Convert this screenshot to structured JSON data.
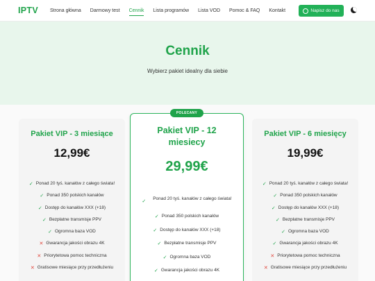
{
  "nav": {
    "logo": "IPTV",
    "links": [
      {
        "label": "Strona główna",
        "active": false
      },
      {
        "label": "Darmowy test",
        "active": false
      },
      {
        "label": "Cennik",
        "active": true
      },
      {
        "label": "Lista programów",
        "active": false
      },
      {
        "label": "Lista VOD",
        "active": false
      },
      {
        "label": "Pomoc & FAQ",
        "active": false
      },
      {
        "label": "Kontakt",
        "active": false
      }
    ],
    "cta_label": "Napisz do nas",
    "cta_icon": "whatsapp-icon",
    "theme_icon": "moon-icon"
  },
  "hero": {
    "title": "Cennik",
    "subtitle": "Wybierz pakiet idealny dla siebie"
  },
  "plans": [
    {
      "title": "Pakiet VIP - 3 miesiące",
      "price": "12,99€",
      "features": [
        {
          "text": "Ponad 20 tyś. kanałów z całego świata!",
          "included": true
        },
        {
          "text": "Ponad 350 polskich kanałów",
          "included": true
        },
        {
          "text": "Dostęp do kanałów XXX (+18)",
          "included": true
        },
        {
          "text": "Bezpłatne transmisje PPV",
          "included": true
        },
        {
          "text": "Ogromna baza VOD",
          "included": true
        },
        {
          "text": "Gwarancja jakości obrazu 4K",
          "included": false
        },
        {
          "text": "Priorytetowa pomoc techniczna",
          "included": false
        },
        {
          "text": "Gratisowe miesiące przy przedłużeniu",
          "included": false
        }
      ]
    },
    {
      "badge": "POLECANY",
      "title": "Pakiet VIP - 12 miesiecy",
      "price": "29,99€",
      "features": [
        {
          "text": "Ponad 20 tyś. kanałów z całego świata!",
          "included": true
        },
        {
          "text": "Ponad 350 polskich kanałów",
          "included": true
        },
        {
          "text": "Dostęp do kanałów XXX (+18)",
          "included": true
        },
        {
          "text": "Bezpłatne transmisje PPV",
          "included": true
        },
        {
          "text": "Ogromna baza VOD",
          "included": true
        },
        {
          "text": "Gwarancja jakości obrazu 4K",
          "included": true
        }
      ]
    },
    {
      "title": "Pakiet VIP - 6 miesięcy",
      "price": "19,99€",
      "features": [
        {
          "text": "Ponad 20 tyś. kanałów z całego świata!",
          "included": true
        },
        {
          "text": "Ponad 350 polskich kanałów",
          "included": true
        },
        {
          "text": "Dostęp do kanałów XXX (+18)",
          "included": true
        },
        {
          "text": "Bezpłatne transmisje PPV",
          "included": true
        },
        {
          "text": "Ogromna baza VOD",
          "included": true
        },
        {
          "text": "Gwarancja jakości obrazu 4K",
          "included": true
        },
        {
          "text": "Priorytetowa pomoc techniczna",
          "included": false
        },
        {
          "text": "Gratisowe miesiące przy przedłużeniu",
          "included": false
        }
      ]
    }
  ],
  "colors": {
    "accent": "#1fa34a",
    "hero_bg": "#e8f6ec",
    "included": "#1fa34a",
    "excluded": "#e0443a"
  }
}
